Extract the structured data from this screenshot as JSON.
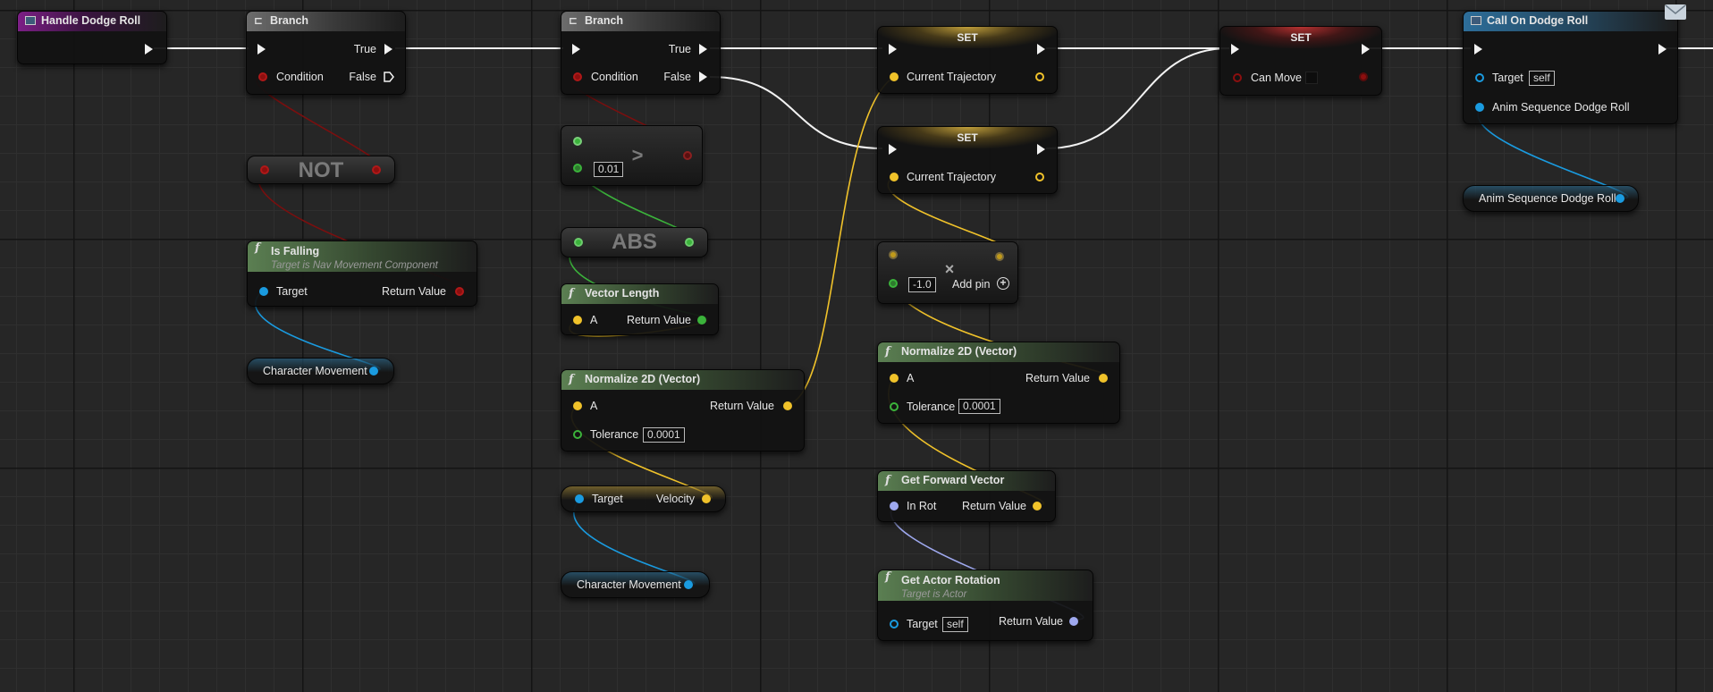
{
  "nodes": {
    "event": {
      "title": "Handle Dodge Roll"
    },
    "branch1": {
      "title": "Branch",
      "true_label": "True",
      "false_label": "False",
      "condition_label": "Condition"
    },
    "branch2": {
      "title": "Branch",
      "true_label": "True",
      "false_label": "False",
      "condition_label": "Condition"
    },
    "not_node": {
      "label": "NOT"
    },
    "is_falling": {
      "title": "Is Falling",
      "subtitle": "Target is Nav Movement Component",
      "target_label": "Target",
      "return_label": "Return Value"
    },
    "char_movement_1": {
      "label": "Character Movement"
    },
    "greater": {
      "symbol": ">",
      "value": "0.01"
    },
    "abs": {
      "label": "ABS"
    },
    "vector_length": {
      "title": "Vector Length",
      "a_label": "A",
      "return_label": "Return Value"
    },
    "normalize1": {
      "title": "Normalize 2D (Vector)",
      "a_label": "A",
      "return_label": "Return Value",
      "tolerance_label": "Tolerance",
      "tolerance_value": "0.0001"
    },
    "velocity": {
      "target_label": "Target",
      "velocity_label": "Velocity"
    },
    "char_movement_2": {
      "label": "Character Movement"
    },
    "set1": {
      "title": "SET",
      "pin_label": "Current Trajectory"
    },
    "set2": {
      "title": "SET",
      "pin_label": "Current Trajectory"
    },
    "multiply": {
      "symbol": "×",
      "value": "-1.0",
      "add_pin_label": "Add pin",
      "add_icon": "plus-circle-icon"
    },
    "normalize2": {
      "title": "Normalize 2D (Vector)",
      "a_label": "A",
      "return_label": "Return Value",
      "tolerance_label": "Tolerance",
      "tolerance_value": "0.0001"
    },
    "forward_vector": {
      "title": "Get Forward Vector",
      "in_label": "In Rot",
      "return_label": "Return Value"
    },
    "actor_rotation": {
      "title": "Get Actor Rotation",
      "subtitle": "Target is Actor",
      "target_label": "Target",
      "target_value": "self",
      "return_label": "Return Value"
    },
    "set_canmove": {
      "title": "SET",
      "pin_label": "Can Move"
    },
    "call_dodge": {
      "title": "Call On Dodge Roll",
      "target_label": "Target",
      "target_value": "self",
      "anim_label": "Anim Sequence Dodge Roll"
    },
    "anim_var": {
      "label": "Anim Sequence Dodge Roll"
    }
  },
  "colors": {
    "exec": "#f2f2f2",
    "bool": "#8c0f0f",
    "float": "#3bb33b",
    "vector": "#f0c22a",
    "object": "#1a9be0",
    "rotator": "#9fa9ef",
    "event_header": "#7c1f86",
    "function_header": "#5b7f52"
  }
}
